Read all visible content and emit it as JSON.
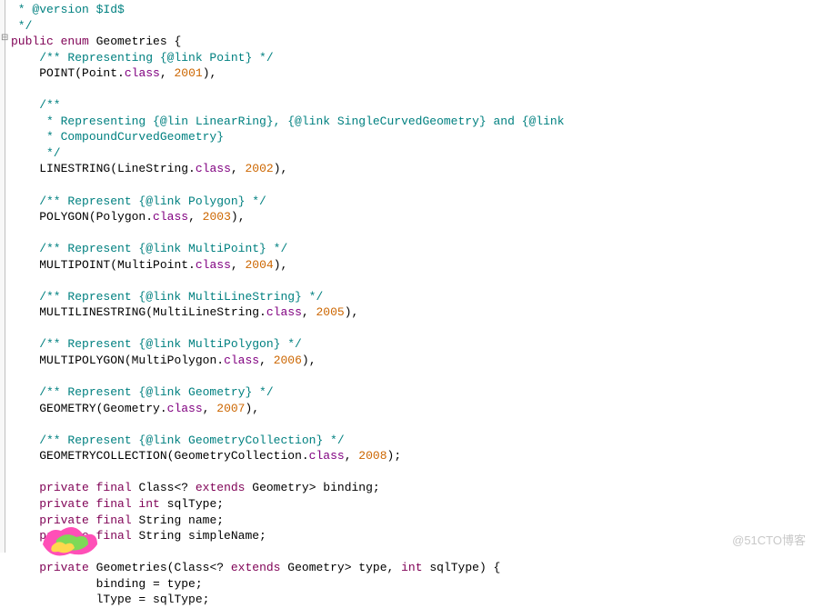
{
  "lines": [
    {
      "i": 0,
      "s": " * @version $Id$",
      "cls": "c-comment"
    },
    {
      "i": 0,
      "s": " */",
      "cls": "c-comment"
    },
    {
      "i": 0,
      "parts": [
        {
          "t": "public ",
          "cls": "c-kw"
        },
        {
          "t": "enum ",
          "cls": "c-kw"
        },
        {
          "t": "Geometries {",
          "cls": "c-black"
        }
      ]
    },
    {
      "i": 1,
      "s": "/** Representing {@link Point} */",
      "cls": "c-comment"
    },
    {
      "i": 1,
      "parts": [
        {
          "t": "POINT(Point.",
          "cls": "c-black"
        },
        {
          "t": "class",
          "cls": "c-purple"
        },
        {
          "t": ", ",
          "cls": "c-black"
        },
        {
          "t": "2001",
          "cls": "c-orange"
        },
        {
          "t": "),",
          "cls": "c-black"
        }
      ]
    },
    {
      "i": 1,
      "s": "",
      "cls": "c-black"
    },
    {
      "i": 1,
      "s": "/**",
      "cls": "c-comment"
    },
    {
      "i": 1,
      "s": " * Representing {@lin LinearRing}, {@link SingleCurvedGeometry} and {@link",
      "cls": "c-comment"
    },
    {
      "i": 1,
      "s": " * CompoundCurvedGeometry}",
      "cls": "c-comment"
    },
    {
      "i": 1,
      "s": " */",
      "cls": "c-comment"
    },
    {
      "i": 1,
      "parts": [
        {
          "t": "LINESTRING(LineString.",
          "cls": "c-black"
        },
        {
          "t": "class",
          "cls": "c-purple"
        },
        {
          "t": ", ",
          "cls": "c-black"
        },
        {
          "t": "2002",
          "cls": "c-orange"
        },
        {
          "t": "),",
          "cls": "c-black"
        }
      ]
    },
    {
      "i": 1,
      "s": "",
      "cls": "c-black"
    },
    {
      "i": 1,
      "s": "/** Represent {@link Polygon} */",
      "cls": "c-comment"
    },
    {
      "i": 1,
      "parts": [
        {
          "t": "POLYGON(Polygon.",
          "cls": "c-black"
        },
        {
          "t": "class",
          "cls": "c-purple"
        },
        {
          "t": ", ",
          "cls": "c-black"
        },
        {
          "t": "2003",
          "cls": "c-orange"
        },
        {
          "t": "),",
          "cls": "c-black"
        }
      ]
    },
    {
      "i": 1,
      "s": "",
      "cls": "c-black"
    },
    {
      "i": 1,
      "s": "/** Represent {@link MultiPoint} */",
      "cls": "c-comment"
    },
    {
      "i": 1,
      "parts": [
        {
          "t": "MULTIPOINT(MultiPoint.",
          "cls": "c-black"
        },
        {
          "t": "class",
          "cls": "c-purple"
        },
        {
          "t": ", ",
          "cls": "c-black"
        },
        {
          "t": "2004",
          "cls": "c-orange"
        },
        {
          "t": "),",
          "cls": "c-black"
        }
      ]
    },
    {
      "i": 1,
      "s": "",
      "cls": "c-black"
    },
    {
      "i": 1,
      "s": "/** Represent {@link MultiLineString} */",
      "cls": "c-comment"
    },
    {
      "i": 1,
      "parts": [
        {
          "t": "MULTILINESTRING(MultiLineString.",
          "cls": "c-black"
        },
        {
          "t": "class",
          "cls": "c-purple"
        },
        {
          "t": ", ",
          "cls": "c-black"
        },
        {
          "t": "2005",
          "cls": "c-orange"
        },
        {
          "t": "),",
          "cls": "c-black"
        }
      ]
    },
    {
      "i": 1,
      "s": "",
      "cls": "c-black"
    },
    {
      "i": 1,
      "s": "/** Represent {@link MultiPolygon} */",
      "cls": "c-comment"
    },
    {
      "i": 1,
      "parts": [
        {
          "t": "MULTIPOLYGON(MultiPolygon.",
          "cls": "c-black"
        },
        {
          "t": "class",
          "cls": "c-purple"
        },
        {
          "t": ", ",
          "cls": "c-black"
        },
        {
          "t": "2006",
          "cls": "c-orange"
        },
        {
          "t": "),",
          "cls": "c-black"
        }
      ]
    },
    {
      "i": 1,
      "s": "",
      "cls": "c-black"
    },
    {
      "i": 1,
      "s": "/** Represent {@link Geometry} */",
      "cls": "c-comment"
    },
    {
      "i": 1,
      "parts": [
        {
          "t": "GEOMETRY(Geometry.",
          "cls": "c-black"
        },
        {
          "t": "class",
          "cls": "c-purple"
        },
        {
          "t": ", ",
          "cls": "c-black"
        },
        {
          "t": "2007",
          "cls": "c-orange"
        },
        {
          "t": "),",
          "cls": "c-black"
        }
      ]
    },
    {
      "i": 1,
      "s": "",
      "cls": "c-black"
    },
    {
      "i": 1,
      "s": "/** Represent {@link GeometryCollection} */",
      "cls": "c-comment"
    },
    {
      "i": 1,
      "parts": [
        {
          "t": "GEOMETRYCOLLECTION(GeometryCollection.",
          "cls": "c-black"
        },
        {
          "t": "class",
          "cls": "c-purple"
        },
        {
          "t": ", ",
          "cls": "c-black"
        },
        {
          "t": "2008",
          "cls": "c-orange"
        },
        {
          "t": ");",
          "cls": "c-black"
        }
      ]
    },
    {
      "i": 1,
      "s": "",
      "cls": "c-black"
    },
    {
      "i": 1,
      "parts": [
        {
          "t": "private final ",
          "cls": "c-kw"
        },
        {
          "t": "Class<? ",
          "cls": "c-black"
        },
        {
          "t": "extends ",
          "cls": "c-kw"
        },
        {
          "t": "Geometry> binding;",
          "cls": "c-black"
        }
      ]
    },
    {
      "i": 1,
      "parts": [
        {
          "t": "private final int ",
          "cls": "c-kw"
        },
        {
          "t": "sqlType;",
          "cls": "c-black"
        }
      ]
    },
    {
      "i": 1,
      "parts": [
        {
          "t": "private final ",
          "cls": "c-kw"
        },
        {
          "t": "String name;",
          "cls": "c-black"
        }
      ]
    },
    {
      "i": 1,
      "parts": [
        {
          "t": "private final ",
          "cls": "c-kw"
        },
        {
          "t": "String simpleName;",
          "cls": "c-black"
        }
      ]
    },
    {
      "i": 1,
      "s": "",
      "cls": "c-black"
    },
    {
      "i": 1,
      "parts": [
        {
          "t": "private ",
          "cls": "c-kw"
        },
        {
          "t": "Geometries(Class<? ",
          "cls": "c-black"
        },
        {
          "t": "extends ",
          "cls": "c-kw"
        },
        {
          "t": "Geometry> type, ",
          "cls": "c-black"
        },
        {
          "t": "int ",
          "cls": "c-kw"
        },
        {
          "t": "sqlType) {",
          "cls": "c-black"
        }
      ]
    },
    {
      "i": 2,
      "parts": [
        {
          "t": "    binding = type;",
          "cls": "c-black"
        }
      ]
    },
    {
      "i": 2,
      "parts": [
        {
          "t": "    lType = sqlType;",
          "cls": "c-black"
        }
      ]
    }
  ],
  "watermark": "@51CTO博客"
}
